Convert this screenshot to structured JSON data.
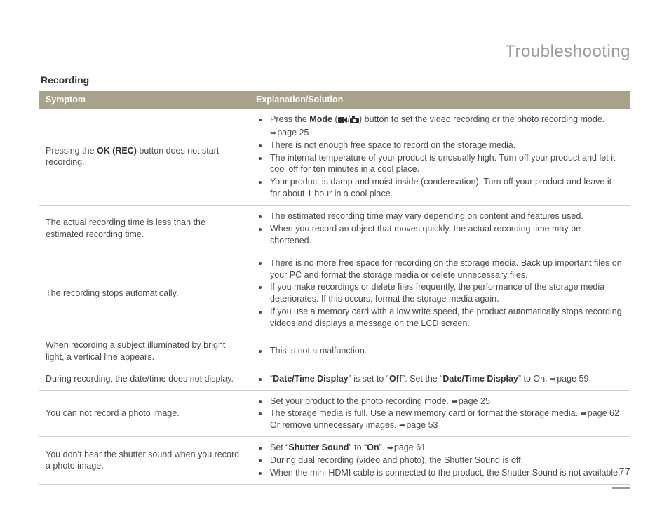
{
  "page_title": "Troubleshooting",
  "section_title": "Recording",
  "headers": {
    "symptom": "Symptom",
    "solution": "Explanation/Solution"
  },
  "page_number": "77",
  "rows": [
    {
      "symptom_pre": "Pressing the ",
      "symptom_bold": "OK (REC)",
      "symptom_post": " button does not start recording.",
      "s1a": "Press the ",
      "s1b": "Mode",
      "s1c": " (",
      "s1d": "/",
      "s1e": ") button to set the video recording or the photo recording mode. ",
      "s1f": "page 25",
      "s2": "There is not enough free space to record on the storage media.",
      "s3": "The internal temperature of your product is unusually high. Turn off your product and let it cool off for ten minutes in a cool place.",
      "s4": "Your product is damp and moist inside (condensation). Turn off your product and leave it for about 1 hour in a cool place."
    },
    {
      "symptom": "The actual recording time is less than the estimated recording time.",
      "s1": "The estimated recording time may vary depending on content and features used.",
      "s2": "When you record an object that moves quickly, the actual recording time may be shortened."
    },
    {
      "symptom": "The recording stops automatically.",
      "s1": "There is no more free space for recording on the storage media. Back up important files on your PC and format the storage media or delete unnecessary files.",
      "s2": "If you make recordings or delete files frequently, the performance of the storage media deteriorates. If this occurs, format the storage media again.",
      "s3": "If you use a memory card with a low write speed, the product automatically stops recording videos and displays a message on the LCD screen."
    },
    {
      "symptom": "When recording a subject illuminated by bright light, a vertical line appears.",
      "s1": "This is not a malfunction."
    },
    {
      "symptom": "During recording, the date/time does not display.",
      "s1a": "“",
      "s1b": "Date/Time Display",
      "s1c": "” is set to “",
      "s1d": "Off",
      "s1e": "”. Set the “",
      "s1f": "Date/Time Display",
      "s1g": "” to On. ",
      "s1h": "page 59"
    },
    {
      "symptom": "You can not record a photo image.",
      "s1a": "Set your product to the photo recording mode. ",
      "s1b": "page 25",
      "s2a": "The storage media is full. Use a new memory card or format the storage media. ",
      "s2b": "page 62 Or remove unnecessary images. ",
      "s2c": "page 53"
    },
    {
      "symptom": "You don’t hear the shutter sound when you record a photo image.",
      "s1a": "Set “",
      "s1b": "Shutter Sound",
      "s1c": "” to “",
      "s1d": "On",
      "s1e": "”. ",
      "s1f": "page 61",
      "s2": "During dual recording (video and photo), the Shutter Sound is off.",
      "s3": "When the mini HDMI cable is connected to the product, the Shutter Sound is not available."
    }
  ]
}
